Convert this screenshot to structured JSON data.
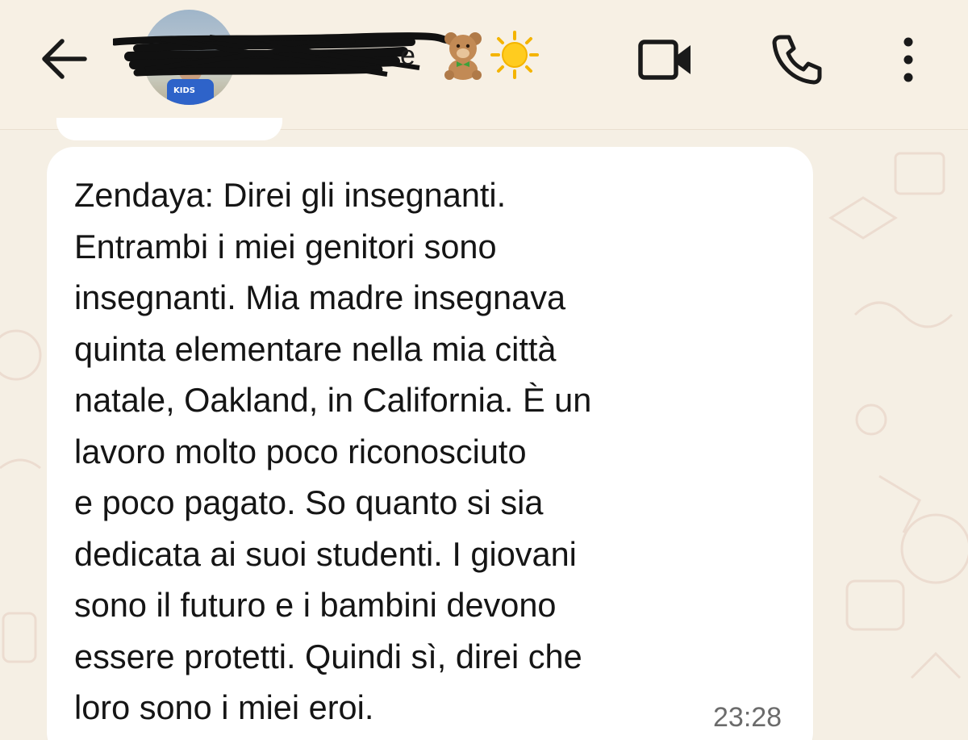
{
  "header": {
    "back_icon": "arrow-left-icon",
    "avatar_shirt_text": "KIDS",
    "contact_name_visible": "e",
    "contact_name_emojis": [
      "teddy-bear",
      "sun"
    ],
    "video_call_icon": "video-camera-icon",
    "voice_call_icon": "phone-icon",
    "menu_icon": "more-vertical-icon"
  },
  "message": {
    "text": "Zendaya: Direi gli insegnanti.\nEntrambi i miei genitori sono\ninsegnanti. Mia madre insegnava\nquinta elementare nella mia città\nnatale, Oakland, in California. È un\nlavoro molto poco riconosciuto\ne poco pagato. So quanto si sia\ndedicata ai suoi studenti. I giovani\nsono il futuro e i bambini devono\nessere protetti. Quindi sì, direi che\nloro sono i miei eroi.",
    "time": "23:28"
  },
  "colors": {
    "background": "#f5efe4",
    "bubble": "#ffffff",
    "text": "#151515",
    "timestamp": "#6b6b6b",
    "icon": "#1a1a1a",
    "redaction": "#111111"
  }
}
